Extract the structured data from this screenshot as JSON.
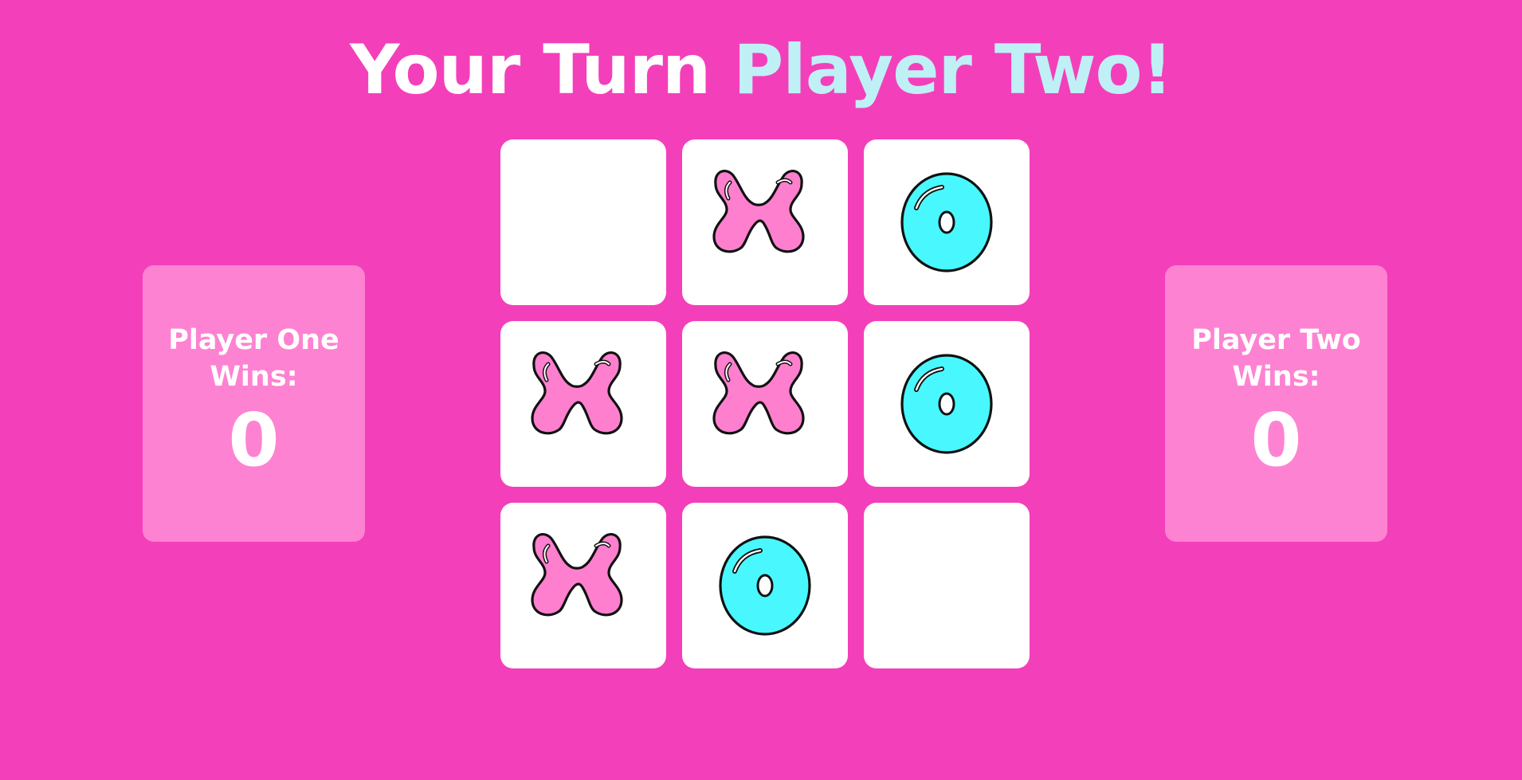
{
  "header": {
    "title_prefix": "Your Turn",
    "title_player": "Player Two!"
  },
  "board": {
    "cells": [
      "",
      "X",
      "O",
      "X",
      "X",
      "O",
      "X",
      "O",
      ""
    ]
  },
  "scores": {
    "player_one": {
      "label": "Player One Wins:",
      "wins": "0"
    },
    "player_two": {
      "label": "Player Two Wins:",
      "wins": "0"
    }
  },
  "colors": {
    "background": "#f43fba",
    "card": "#fe82d2",
    "x_fill": "#ff7fcf",
    "o_fill": "#48f8fe",
    "title_accent": "#bff0f6"
  }
}
